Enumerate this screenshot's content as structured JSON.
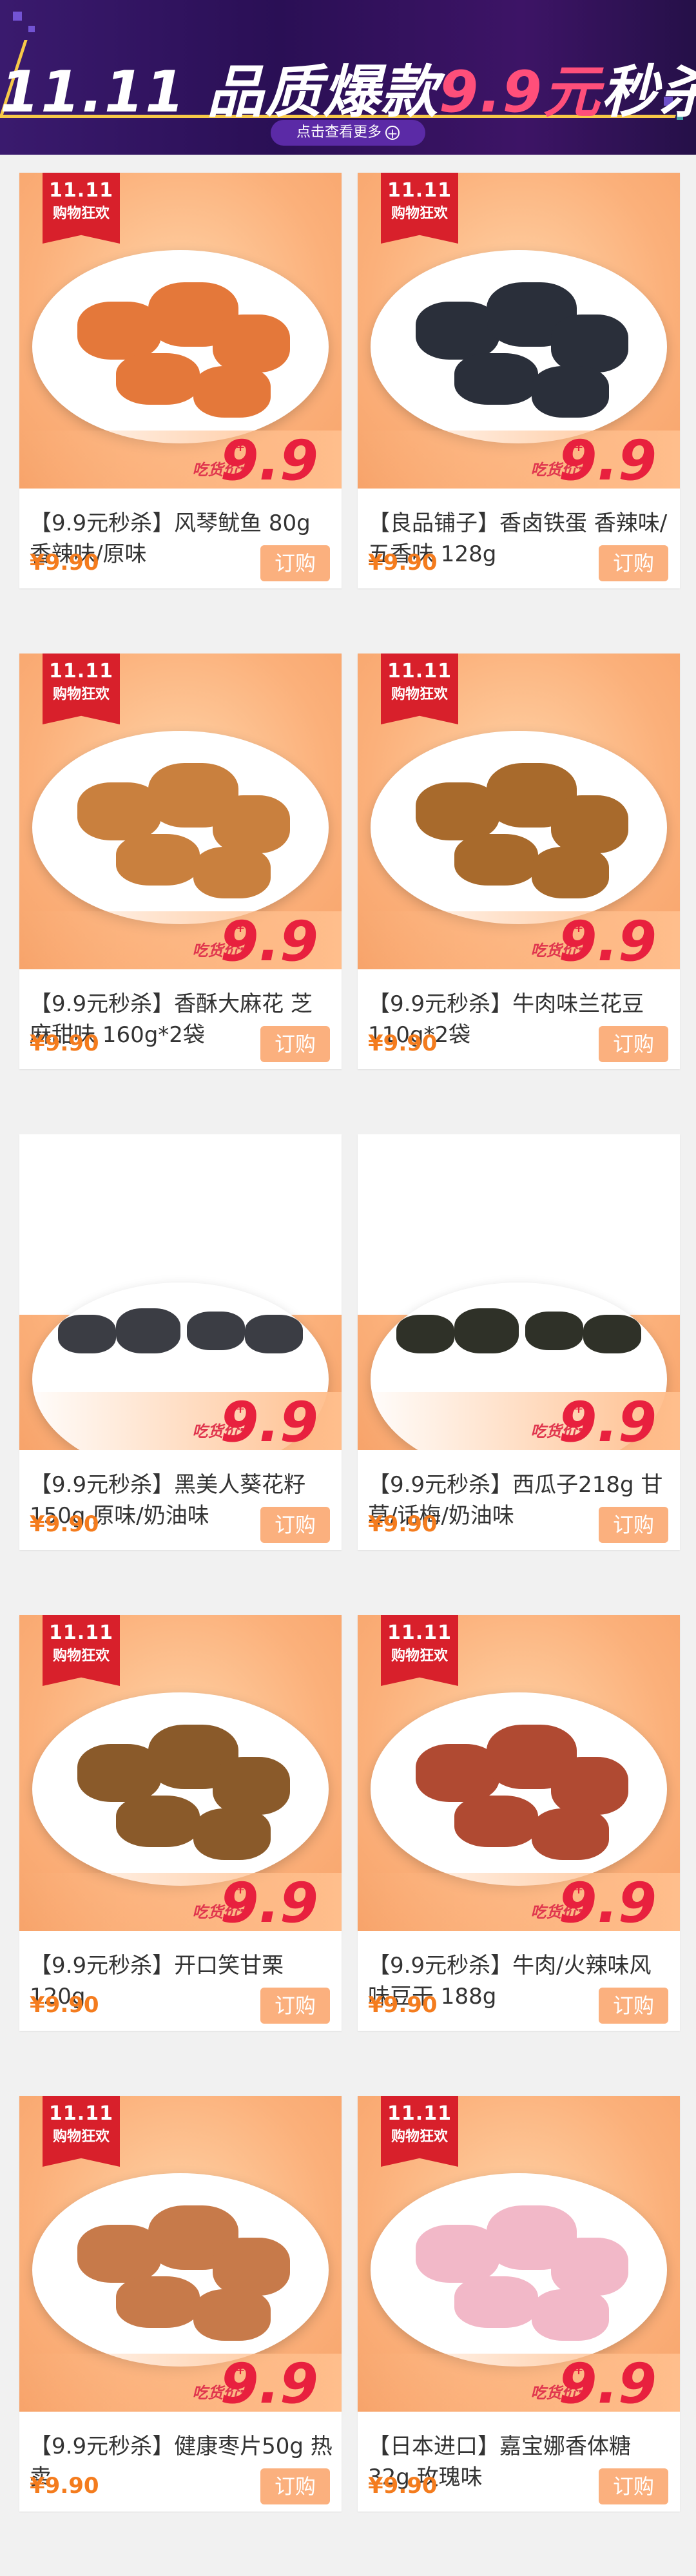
{
  "banner": {
    "title_prefix": "11.11 品质爆款",
    "title_highlight": "9.9元",
    "title_suffix": "秒杀",
    "cta_label": "点击查看更多",
    "cta_icon": "plus-circle-icon"
  },
  "product_tag": {
    "line1": "11.11",
    "line2": "购物狂欢"
  },
  "price_badge": {
    "label": "吃货价:",
    "currency": "¥",
    "value": "9.9"
  },
  "order_button_label": "订购",
  "products": [
    {
      "title": "【9.9元秒杀】风琴鱿鱼 80g 香辣味/原味",
      "price": "¥9.90"
    },
    {
      "title": "【良品铺子】香卤铁蛋 香辣味/五香味 128g",
      "price": "¥9.90"
    },
    {
      "title": "【9.9元秒杀】香酥大麻花 芝麻甜味 160g*2袋",
      "price": "¥9.90"
    },
    {
      "title": "【9.9元秒杀】牛肉味兰花豆 110g*2袋",
      "price": "¥9.90"
    },
    {
      "title": "【9.9元秒杀】黑美人葵花籽150g 原味/奶油味",
      "price": "¥9.90"
    },
    {
      "title": "【9.9元秒杀】西瓜子218g 甘草/话梅/奶油味",
      "price": "¥9.90"
    },
    {
      "title": "【9.9元秒杀】开口笑甘栗 120g",
      "price": "¥9.90"
    },
    {
      "title": "【9.9元秒杀】牛肉/火辣味风味豆干 188g",
      "price": "¥9.90"
    },
    {
      "title": "【9.9元秒杀】健康枣片50g 热卖",
      "price": "¥9.90"
    },
    {
      "title": "【日本进口】嘉宝娜香体糖 32g 玫瑰味",
      "price": "¥9.90"
    }
  ]
}
